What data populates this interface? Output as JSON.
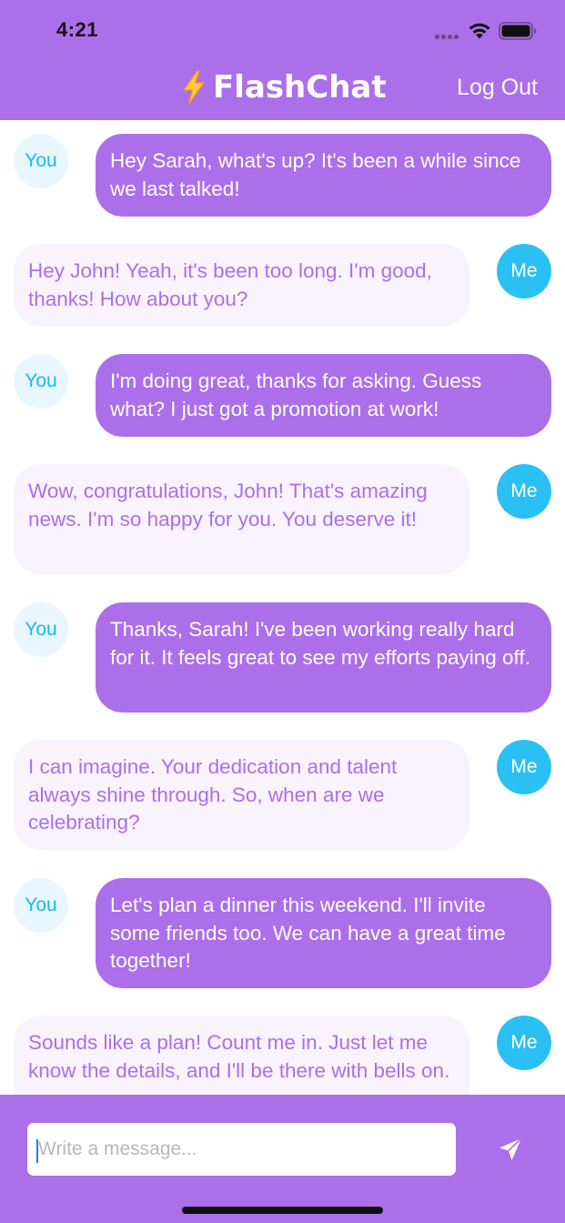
{
  "status_bar": {
    "time": "4:21"
  },
  "nav": {
    "title": "FlashChat",
    "logout_label": "Log Out"
  },
  "messages": [
    {
      "sender": "You",
      "text": "Hey Sarah, what's up? It's been a while since we last talked!"
    },
    {
      "sender": "Me",
      "text": "Hey John! Yeah, it's been too long. I'm good, thanks! How about you?"
    },
    {
      "sender": "You",
      "text": "I'm doing great, thanks for asking. Guess what? I just got a promotion at work!"
    },
    {
      "sender": "Me",
      "text": "Wow, congratulations, John! That's amazing news. I'm so happy for you. You deserve it!"
    },
    {
      "sender": "You",
      "text": "Thanks, Sarah! I've been working really hard for it. It feels great to see my efforts paying off."
    },
    {
      "sender": "Me",
      "text": "I can imagine. Your dedication and talent always shine through. So, when are we celebrating?"
    },
    {
      "sender": "You",
      "text": "Let's plan a dinner this weekend. I'll invite some friends too. We can have a great time together!"
    },
    {
      "sender": "Me",
      "text": "Sounds like a plan! Count me in. Just let me know the details, and I'll be there with bells on."
    }
  ],
  "composer": {
    "placeholder": "Write a message...",
    "value": ""
  },
  "icons": {
    "brand": "lightning-bolt-icon",
    "send": "paper-plane-icon"
  },
  "colors": {
    "brand_purple": "#AC6FEA",
    "incoming_bubble": "#F8F3FD",
    "me_avatar": "#2BC0F4",
    "you_avatar_bg": "#E8F7FD",
    "you_avatar_text": "#1DB5F6"
  }
}
